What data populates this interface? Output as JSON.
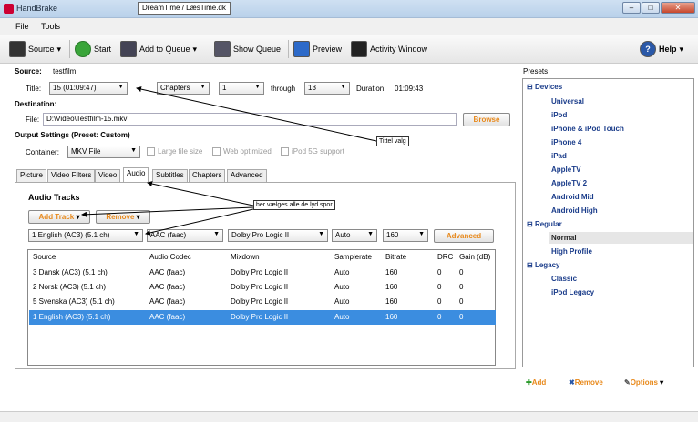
{
  "window": {
    "title": "HandBrake",
    "caption": "DreamTime / LæsTime.dk"
  },
  "menu": [
    "File",
    "Tools"
  ],
  "toolbar": {
    "source": "Source",
    "start": "Start",
    "add_to_queue": "Add to Queue",
    "show_queue": "Show Queue",
    "preview": "Preview",
    "activity": "Activity Window",
    "help": "Help"
  },
  "source": {
    "label": "Source:",
    "value": "testfilm",
    "title_label": "Title:",
    "title_value": "15 (01:09:47)",
    "chapters_mode": "Chapters",
    "chapter_from": "1",
    "through": "through",
    "chapter_to": "13",
    "duration_label": "Duration:",
    "duration": "01:09:43"
  },
  "destination": {
    "label": "Destination:",
    "file_label": "File:",
    "file_value": "D:\\Video\\Testfilm-15.mkv",
    "browse": "Browse"
  },
  "output": {
    "label": "Output Settings (Preset: Custom)",
    "container_label": "Container:",
    "container": "MKV File",
    "large_file": "Large file size",
    "web_opt": "Web optimized",
    "ipod5g": "iPod 5G support"
  },
  "tabs": [
    "Picture",
    "Video Filters",
    "Video",
    "Audio",
    "Subtitles",
    "Chapters",
    "Advanced"
  ],
  "audio": {
    "heading": "Audio Tracks",
    "add_track": "Add Track",
    "remove": "Remove",
    "edit": {
      "source": "1 English (AC3) (5.1 ch)",
      "codec": "AAC (faac)",
      "mixdown": "Dolby Pro Logic II",
      "samplerate": "Auto",
      "bitrate": "160",
      "advanced": "Advanced"
    },
    "columns": [
      "Source",
      "Audio Codec",
      "Mixdown",
      "Samplerate",
      "Bitrate",
      "DRC",
      "Gain (dB)"
    ],
    "rows": [
      [
        "3 Dansk (AC3) (5.1 ch)",
        "AAC (faac)",
        "Dolby Pro Logic II",
        "Auto",
        "160",
        "0",
        "0"
      ],
      [
        "2 Norsk (AC3) (5.1 ch)",
        "AAC (faac)",
        "Dolby Pro Logic II",
        "Auto",
        "160",
        "0",
        "0"
      ],
      [
        "5 Svenska (AC3) (5.1 ch)",
        "AAC (faac)",
        "Dolby Pro Logic II",
        "Auto",
        "160",
        "0",
        "0"
      ],
      [
        "1 English (AC3) (5.1 ch)",
        "AAC (faac)",
        "Dolby Pro Logic II",
        "Auto",
        "160",
        "0",
        "0"
      ]
    ]
  },
  "presets": {
    "heading": "Presets",
    "groups": [
      {
        "name": "Devices",
        "items": [
          "Universal",
          "iPod",
          "iPhone & iPod Touch",
          "iPhone 4",
          "iPad",
          "AppleTV",
          "AppleTV 2",
          "Android Mid",
          "Android High"
        ]
      },
      {
        "name": "Regular",
        "items": [
          "Normal",
          "High Profile"
        ]
      },
      {
        "name": "Legacy",
        "items": [
          "Classic",
          "iPod Legacy"
        ]
      }
    ],
    "add": "Add",
    "remove": "Remove",
    "options": "Options"
  },
  "callouts": {
    "title": "Tittel valg",
    "tracks": "her vælges alle de lyd spor"
  },
  "colors": {
    "selection": "#3b8de0",
    "preset_text": "#1a3c8a",
    "orange": "#e8891b"
  }
}
